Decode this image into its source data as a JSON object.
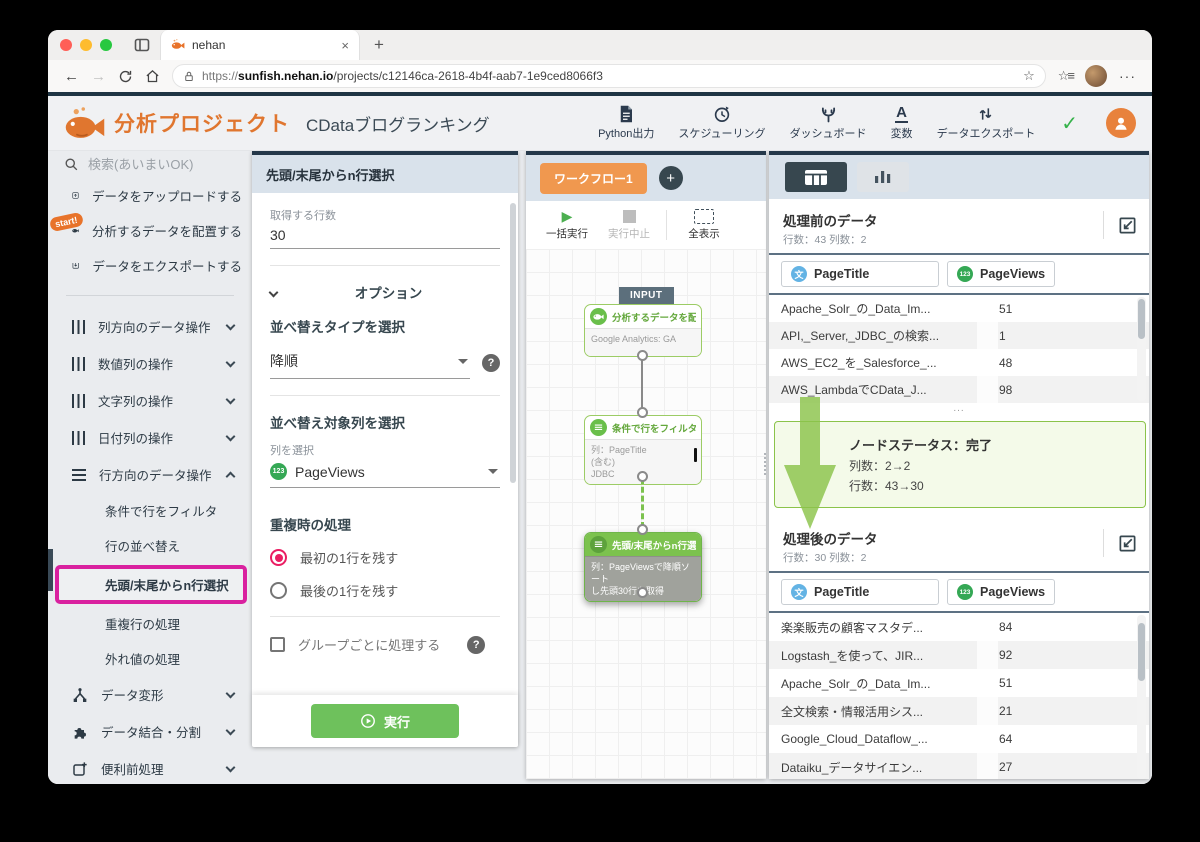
{
  "browser": {
    "tab_title": "nehan",
    "close_glyph": "×",
    "new_tab_glyph": "+",
    "back_glyph": "←",
    "forward_glyph": "→",
    "url_scheme": "https://",
    "url_domain": "sunfish.nehan.io",
    "url_path": "/projects/c12146ca-2618-4b4f-aab7-1e9ced8066f3",
    "star_glyph": "☆",
    "collections_glyph": "☆≡",
    "menu_glyph": "···"
  },
  "header": {
    "logo_text": "分析プロジェクト",
    "project_title": "CDataブログランキング",
    "tools": [
      {
        "label": "Python出力"
      },
      {
        "label": "スケジューリング"
      },
      {
        "label": "ダッシュボード"
      },
      {
        "label": "変数",
        "glyph": "A"
      },
      {
        "label": "データエクスポート"
      }
    ],
    "check_glyph": "✓"
  },
  "sidebar": {
    "search_placeholder": "検索(あいまいOK)",
    "top_items": [
      {
        "label": "データをアップロードする"
      },
      {
        "label": "分析するデータを配置する",
        "badge": "start!"
      },
      {
        "label": "データをエクスポートする"
      }
    ],
    "categories": [
      {
        "label": "列方向のデータ操作"
      },
      {
        "label": "数値列の操作"
      },
      {
        "label": "文字列の操作"
      },
      {
        "label": "日付列の操作"
      },
      {
        "label": "行方向のデータ操作"
      }
    ],
    "row_children": [
      {
        "label": "条件で行をフィルタ"
      },
      {
        "label": "行の並べ替え"
      },
      {
        "label": "先頭/末尾からn行選択"
      },
      {
        "label": "重複行の処理"
      },
      {
        "label": "外れ値の処理"
      }
    ],
    "bottom_categories": [
      {
        "label": "データ変形"
      },
      {
        "label": "データ結合・分割"
      },
      {
        "label": "便利前処理"
      }
    ]
  },
  "settings": {
    "title": "先頭/末尾からn行選択",
    "row_count_label": "取得する行数",
    "row_count_value": "30",
    "options_label": "オプション",
    "sort_type_label": "並べ替えタイプを選択",
    "sort_type_value": "降順",
    "sort_target_label": "並べ替え対象列を選択",
    "column_select_label": "列を選択",
    "column_value": "PageViews",
    "column_badge": "123",
    "duplicate_label": "重複時の処理",
    "radio_first": "最初の1行を残す",
    "radio_last": "最後の1行を残す",
    "group_checkbox_label": "グループごとに処理する",
    "help_glyph": "?",
    "run_label": "実行"
  },
  "workflow": {
    "tab_label": "ワークフロー1",
    "add_glyph": "+",
    "run_all_label": "一括実行",
    "stop_label": "実行中止",
    "fit_label": "全表示",
    "play_glyph": "▶",
    "input_label": "INPUT",
    "node1": {
      "title": "分析するデータを配...",
      "body": "Google Analytics: GA"
    },
    "node2": {
      "title": "条件で行をフィルタ",
      "line1": "列：PageTitle",
      "line2": "(含む)",
      "line3": "JDBC"
    },
    "node3": {
      "title": "先頭/末尾からn行選択",
      "line1": "列：PageViewsで降順ソート",
      "line2": "し先頭30行を取得"
    }
  },
  "data_panel": {
    "before": {
      "title": "処理前のデータ",
      "meta": "行数：43 列数：2",
      "col1": "PageTitle",
      "col1_badge": "文",
      "col2": "PageViews",
      "col2_badge": "123",
      "rows": [
        {
          "t": "Apache_Solr_の_Data_Im...",
          "v": "51"
        },
        {
          "t": "API,_Server,_JDBC_の検索...",
          "v": "1"
        },
        {
          "t": "AWS_EC2_を_Salesforce_...",
          "v": "48"
        },
        {
          "t": "AWS_LambdaでCData_J...",
          "v": "98"
        }
      ]
    },
    "ellipsis": "...",
    "status": {
      "line1": "ノードステータス：完了",
      "line2": "列数：2→2",
      "line3": "行数：43→30"
    },
    "after": {
      "title": "処理後のデータ",
      "meta": "行数：30 列数：2",
      "col1": "PageTitle",
      "col1_badge": "文",
      "col2": "PageViews",
      "col2_badge": "123",
      "rows": [
        {
          "t": "楽楽販売の顧客マスタデ...",
          "v": "84"
        },
        {
          "t": "Logstash_を使って、JIR...",
          "v": "92"
        },
        {
          "t": "Apache_Solr_の_Data_Im...",
          "v": "51"
        },
        {
          "t": "全文検索・情報活用シス...",
          "v": "21"
        },
        {
          "t": "Google_Cloud_Dataflow_...",
          "v": "64"
        },
        {
          "t": "Dataiku_データサイエン...",
          "v": "27"
        }
      ]
    }
  },
  "colors": {
    "accent_orange": "#e0762f",
    "workflow_tab_orange": "#f0984f",
    "accent_green": "#7cc24e",
    "run_button_green": "#6ec15c",
    "magenta_highlight": "#d9219f",
    "dark_slate": "#24384a",
    "panel_header_blue": "#d9e2eb",
    "radio_pink": "#ea1e63",
    "status_green_border": "#8bc34a"
  }
}
